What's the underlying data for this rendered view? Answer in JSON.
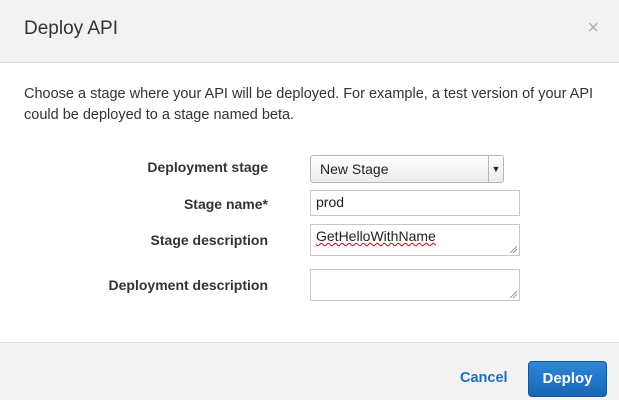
{
  "dialog": {
    "title": "Deploy API",
    "close_symbol": "×",
    "intro": "Choose a stage where your API will be deployed. For example, a test version of your API could be deployed to a stage named beta."
  },
  "form": {
    "deployment_stage_label": "Deployment stage",
    "deployment_stage_value": "New Stage",
    "stage_name_label": "Stage name*",
    "stage_name_value": "prod",
    "stage_description_label": "Stage description",
    "stage_description_value": "GetHelloWithName",
    "deployment_description_label": "Deployment description",
    "deployment_description_value": ""
  },
  "footer": {
    "cancel_label": "Cancel",
    "deploy_label": "Deploy"
  },
  "icons": {
    "close": "close-icon",
    "dropdown": "dropdown-arrow-icon",
    "resize": "resize-grip-icon"
  },
  "colors": {
    "primary": "#1a6fba",
    "header_bg": "#f2f2f2",
    "error_underline": "#d0021b"
  }
}
